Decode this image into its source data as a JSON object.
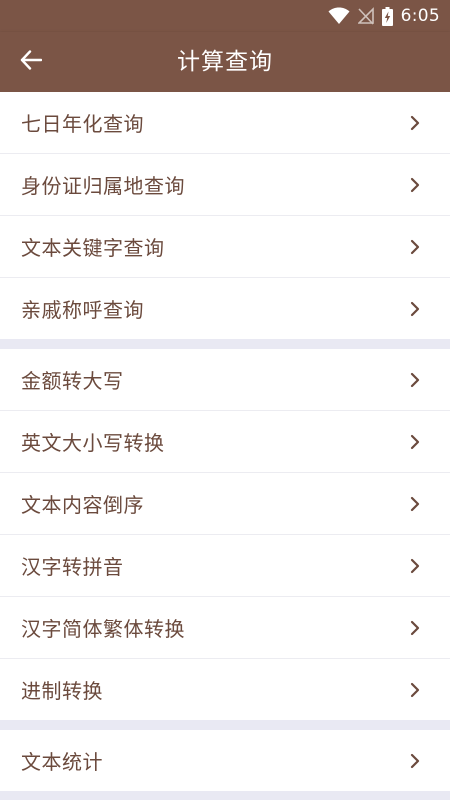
{
  "status_bar": {
    "time": "6:05",
    "icons": [
      "wifi-icon",
      "signal-off-icon",
      "battery-charging-icon"
    ]
  },
  "app_bar": {
    "title": "计算查询",
    "back_icon": "arrow-left-icon"
  },
  "groups": [
    {
      "items": [
        {
          "label": "七日年化查询"
        },
        {
          "label": "身份证归属地查询"
        },
        {
          "label": "文本关键字查询"
        },
        {
          "label": "亲戚称呼查询"
        }
      ]
    },
    {
      "items": [
        {
          "label": "金额转大写"
        },
        {
          "label": "英文大小写转换"
        },
        {
          "label": "文本内容倒序"
        },
        {
          "label": "汉字转拼音"
        },
        {
          "label": "汉字简体繁体转换"
        },
        {
          "label": "进制转换"
        }
      ]
    },
    {
      "items": [
        {
          "label": "文本统计"
        }
      ]
    }
  ],
  "colors": {
    "header": "#7b5546",
    "text": "#6b4a3d",
    "divider": "#e9e9f3"
  }
}
